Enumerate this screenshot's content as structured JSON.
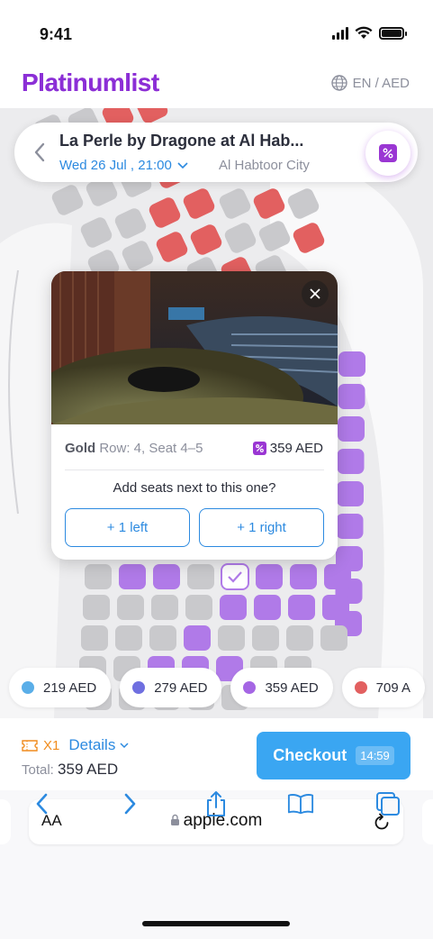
{
  "status_bar": {
    "time": "9:41"
  },
  "header": {
    "logo": "Platinumlist",
    "locale": "EN / AED"
  },
  "event": {
    "title": "La Perle by Dragone at Al Hab...",
    "date": "Wed 26 Jul , 21:00",
    "venue": "Al Habtoor City"
  },
  "popup": {
    "category": "Gold",
    "seat": "Row: 4, Seat 4–5",
    "price": "359 AED",
    "question": "Add seats next to this one?",
    "add_left": "+ 1 left",
    "add_right": "+ 1 right"
  },
  "legend": [
    {
      "label": "219 AED",
      "color": "#5aaee8"
    },
    {
      "label": "279 AED",
      "color": "#6f6fe0"
    },
    {
      "label": "359 AED",
      "color": "#a566e4"
    },
    {
      "label": "709 A",
      "color": "#e26060"
    }
  ],
  "checkout": {
    "ticket_count": "X1",
    "details_label": "Details",
    "total_label": "Total:",
    "total_value": "359 AED",
    "button_label": "Checkout",
    "timer": "14:59"
  },
  "browser": {
    "aa": "AA",
    "url": "apple.com"
  },
  "colors": {
    "accent": "#2c8ae0",
    "brand": "#9a36d3",
    "seat_red": "#e26060",
    "seat_purple": "#b07ae8",
    "seat_grey": "#c9c9cc"
  }
}
